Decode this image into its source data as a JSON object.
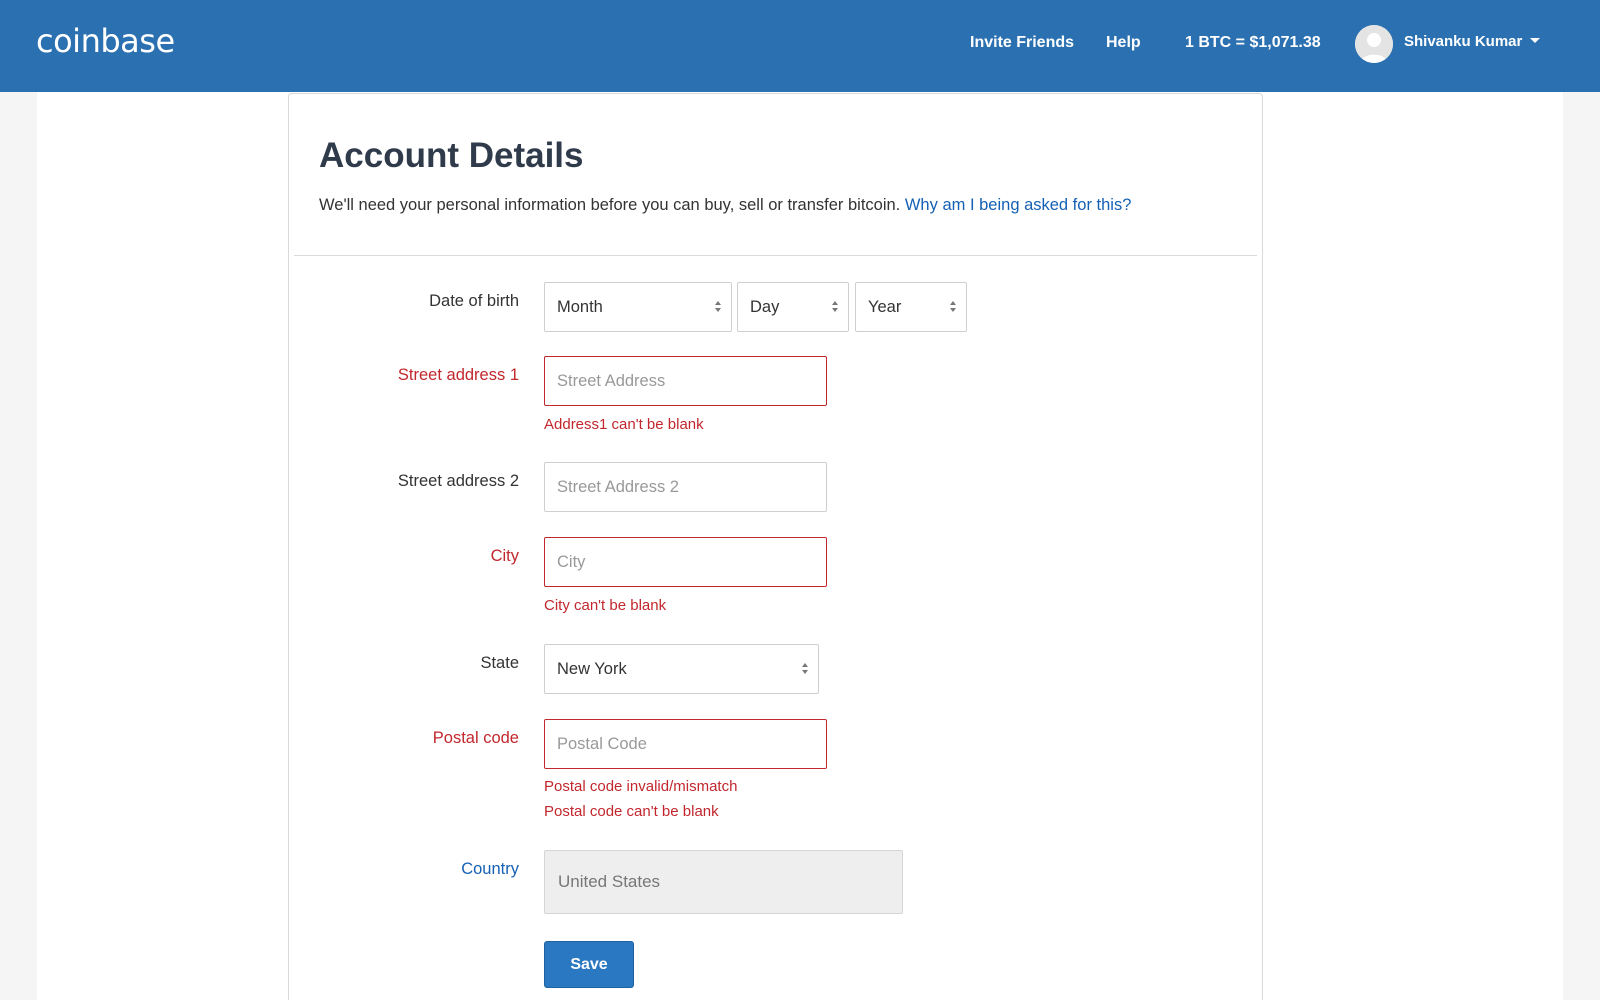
{
  "header": {
    "logo": "coinbase",
    "invite_friends": "Invite Friends",
    "help": "Help",
    "btc_price": "1 BTC = $1,071.38",
    "user_name": "Shivanku Kumar"
  },
  "main": {
    "title": "Account Details",
    "intro": "We'll need your personal information before you can buy, sell or transfer bitcoin.",
    "intro_link": "Why am I being asked for this?"
  },
  "form": {
    "dob": {
      "label": "Date of birth",
      "month": "Month",
      "day": "Day",
      "year": "Year"
    },
    "street1": {
      "label": "Street address 1",
      "placeholder": "Street Address",
      "value": "",
      "error": "Address1 can't be blank"
    },
    "street2": {
      "label": "Street address 2",
      "placeholder": "Street Address 2",
      "value": ""
    },
    "city": {
      "label": "City",
      "placeholder": "City",
      "value": "",
      "error": "City can't be blank"
    },
    "state": {
      "label": "State",
      "value": "New York"
    },
    "postal": {
      "label": "Postal code",
      "placeholder": "Postal Code",
      "value": "",
      "error1": "Postal code invalid/mismatch",
      "error2": "Postal code can't be blank"
    },
    "country": {
      "label": "Country",
      "value": "United States"
    },
    "save_label": "Save"
  },
  "colors": {
    "brand": "#2b71b1",
    "error": "#c1272d",
    "link": "#1560b5",
    "button": "#2b78c2"
  }
}
